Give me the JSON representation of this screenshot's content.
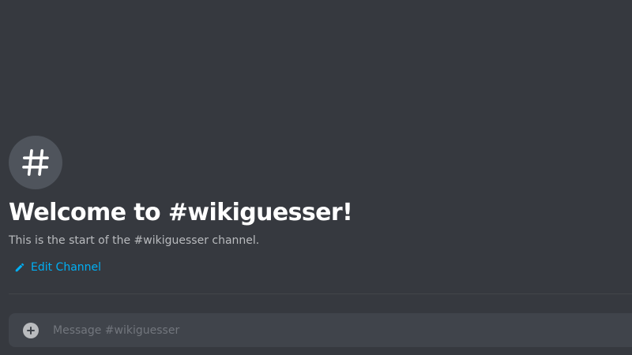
{
  "channel": {
    "icon": "hashtag-icon",
    "welcome_title": "Welcome to #wikiguesser!",
    "welcome_subtitle": "This is the start of the #wikiguesser channel.",
    "edit_label": "Edit Channel",
    "edit_icon": "pencil-icon"
  },
  "composer": {
    "add_icon": "plus-circle-icon",
    "placeholder": "Message #wikiguesser",
    "value": ""
  },
  "colors": {
    "background": "#36393f",
    "accent_link": "#00aff4",
    "input_background": "#40444b"
  }
}
